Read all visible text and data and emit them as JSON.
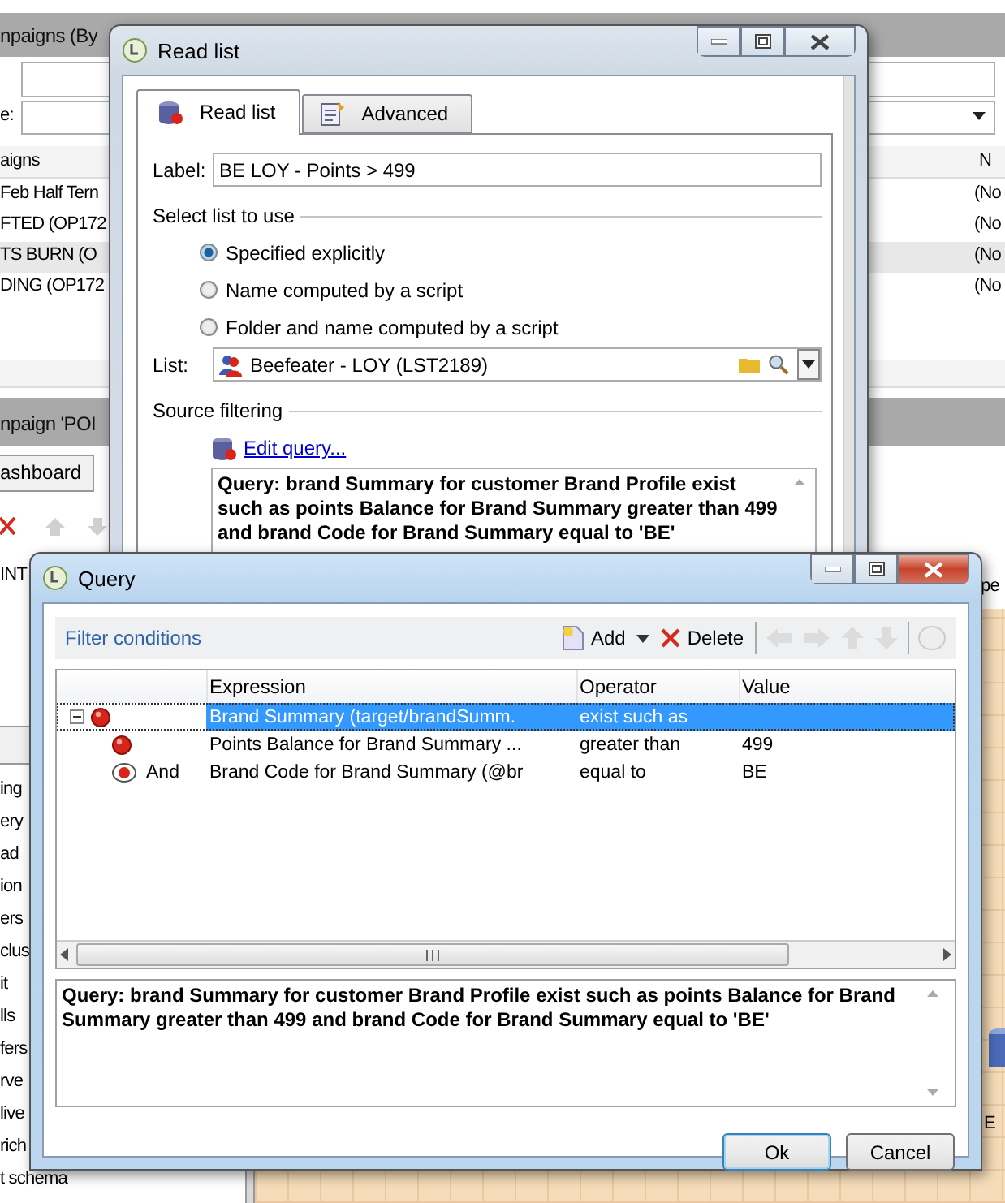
{
  "background_app": {
    "top_panel": {
      "title": "npaigns (By",
      "field_label": "e:",
      "column_1": "aigns",
      "column_2": "N",
      "rows": [
        {
          "column_1": "Feb Half Tern",
          "column_2": "(No",
          "selected": false
        },
        {
          "column_1": "FTED (OP172",
          "column_2": "(No",
          "selected": false
        },
        {
          "column_1": "TS BURN (O",
          "column_2": "(No",
          "selected": true
        },
        {
          "column_1": "DING (OP172",
          "column_2": "(No",
          "selected": false
        }
      ]
    },
    "bottom_panel": {
      "title": "npaign 'POI",
      "tab": "ashboard",
      "node_label": "INT",
      "items": [
        "ing",
        "ery",
        "ad",
        "ion",
        "ers",
        "clus",
        "it",
        "lls",
        "fers",
        "rve",
        "live",
        "rich",
        "t schema"
      ],
      "canvas_caption": "pe",
      "canvas_node": "E"
    }
  },
  "read_list": {
    "title": "Read list",
    "tabs": [
      {
        "label": "Read list",
        "selected": true
      },
      {
        "label": "Advanced",
        "selected": false
      }
    ],
    "label_caption": "Label:",
    "label_value": "BE LOY - Points > 499",
    "select_group": "Select list to use",
    "options": [
      {
        "label": "Specified explicitly",
        "selected": true
      },
      {
        "label": "Name computed by a script",
        "selected": false
      },
      {
        "label": "Folder and name computed by a script",
        "selected": false
      }
    ],
    "list_caption": "List:",
    "list_value": "Beefeater - LOY (LST2189)",
    "source_group": "Source filtering",
    "edit_link": "Edit query...",
    "query_text": "Query: brand Summary for customer Brand Profile exist such as points Balance for Brand Summary greater than 499 and brand Code for Brand Summary equal to 'BE'"
  },
  "query": {
    "title": "Query",
    "section": "Filter conditions",
    "toolbar": [
      {
        "kind": "add",
        "label": "Add"
      },
      {
        "kind": "delete",
        "label": "Delete"
      }
    ],
    "columns": [
      "Expression",
      "Operator",
      "Value"
    ],
    "rows": [
      {
        "kind": "condition",
        "expanded": true,
        "selected": true,
        "expression": "Brand Summary (target/brandSumm.",
        "operator": "exist such as",
        "children": [
          {
            "kind": "condition",
            "selected": false,
            "expression": "Points Balance for Brand Summary ...",
            "operator": "greater than",
            "value": "499"
          },
          {
            "kind": "and",
            "selected": false,
            "connector": "And",
            "expression": "Brand Code for Brand Summary (@br",
            "operator": "equal to",
            "value": "BE"
          }
        ]
      }
    ],
    "summary": "Query: brand Summary for customer Brand Profile exist such as points Balance for Brand Summary greater than 499 and brand Code for Brand Summary equal to 'BE'",
    "buttons": [
      {
        "label": "Ok",
        "default": true
      },
      {
        "label": "Cancel",
        "default": false
      }
    ]
  }
}
